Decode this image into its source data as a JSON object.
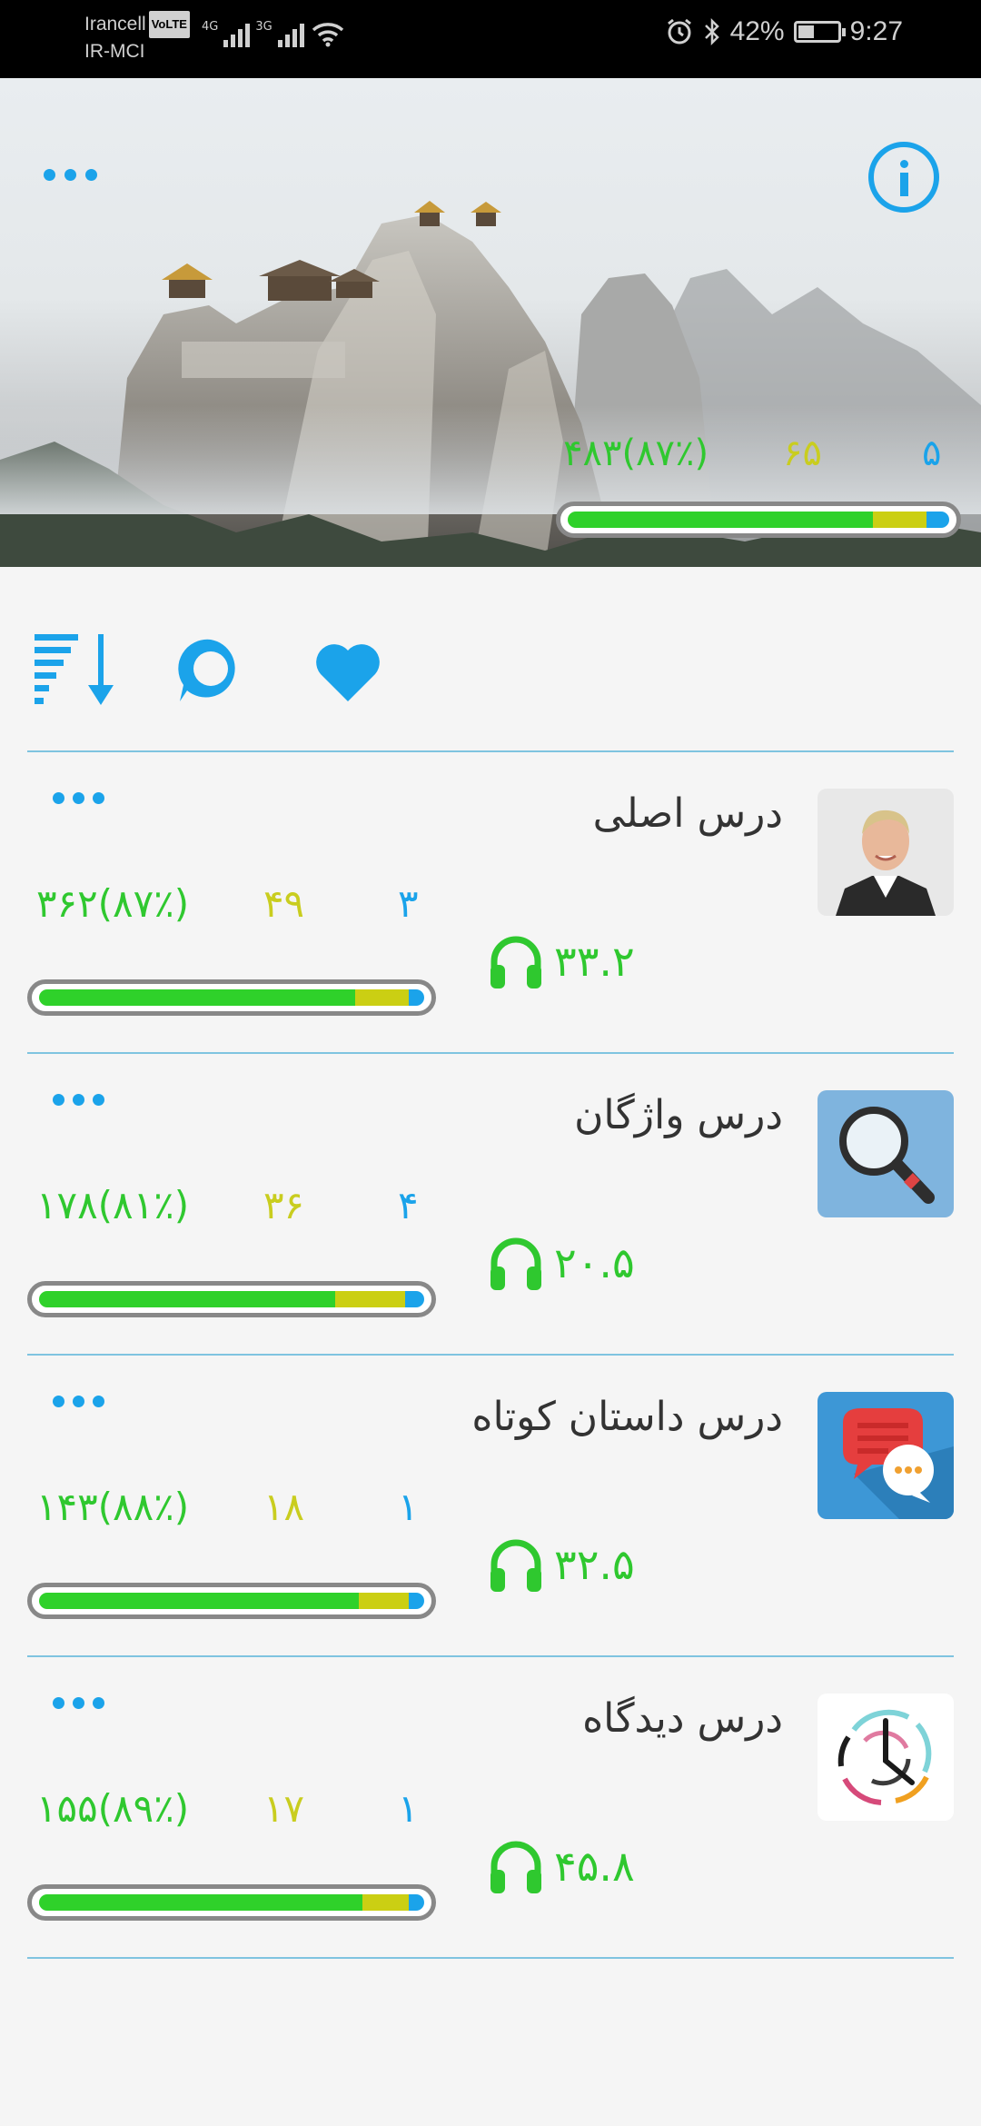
{
  "status_bar": {
    "carrier_1": "Irancell",
    "volte": "VoLTE",
    "carrier_2": "IR-MCI",
    "net_1": "4G",
    "net_2": "3G",
    "battery": "42%",
    "time": "9:27"
  },
  "header": {
    "total": "۴۸۳(۸۷٪)",
    "middle": "۶۵",
    "right": "۵",
    "progress": {
      "green": 0.8,
      "yellow": 0.14,
      "blue": 0.06
    }
  },
  "lessons": [
    {
      "title": "درس اصلی",
      "total": "۳۶۲(۸۷٪)",
      "middle": "۴۹",
      "right": "۳",
      "listen": "۳۳.۲",
      "thumb": "portrait",
      "progress": {
        "green": 0.82,
        "yellow": 0.14,
        "blue": 0.04
      }
    },
    {
      "title": "درس واژگان",
      "total": "۱۷۸(۸۱٪)",
      "middle": "۳۶",
      "right": "۴",
      "listen": "۲۰.۵",
      "thumb": "magnifier",
      "progress": {
        "green": 0.77,
        "yellow": 0.18,
        "blue": 0.05
      }
    },
    {
      "title": "درس داستان کوتاه",
      "total": "۱۴۳(۸۸٪)",
      "middle": "۱۸",
      "right": "۱",
      "listen": "۳۲.۵",
      "thumb": "chat",
      "progress": {
        "green": 0.83,
        "yellow": 0.13,
        "blue": 0.04
      }
    },
    {
      "title": "درس دیدگاه",
      "total": "۱۵۵(۸۹٪)",
      "middle": "۱۷",
      "right": "۱",
      "listen": "۴۵.۸",
      "thumb": "clock",
      "progress": {
        "green": 0.84,
        "yellow": 0.12,
        "blue": 0.04
      }
    }
  ]
}
